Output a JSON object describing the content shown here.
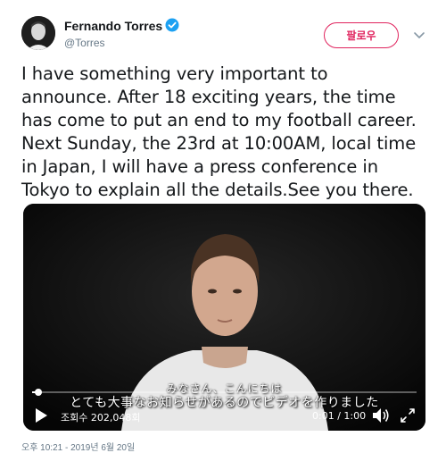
{
  "tweet": {
    "author_name": "Fernando Torres",
    "author_handle": "@Torres",
    "follow_label": "팔로우",
    "text_lines": [
      "I have something very important to",
      "announce. After 18 exciting years, the time",
      "has come to put an end to my football career.",
      "Next Sunday, the 23rd at 10:00AM, local time",
      "in Japan, I will have a press conference in",
      "Tokyo to explain all the details.See you there."
    ]
  },
  "video": {
    "subtitle_line1": "みなさん、こんにちは",
    "subtitle_line2": "とても大事なお知らせがあるのでビデオを作りました",
    "views_label": "조회수 202,048회",
    "time_label": "0:01 / 1:00",
    "progress": 0.017
  },
  "footer": {
    "timestamp": "오후 10:21 - 2019년 6월 20일"
  },
  "icons": {
    "verified": "verified-badge-icon",
    "more": "chevron-down-icon",
    "play": "play-icon",
    "volume": "volume-icon",
    "fullscreen": "fullscreen-icon"
  },
  "colors": {
    "follow_accent": "#e0245e",
    "verified_blue": "#1da1f2",
    "text_primary": "#14171a",
    "text_secondary": "#657786"
  }
}
